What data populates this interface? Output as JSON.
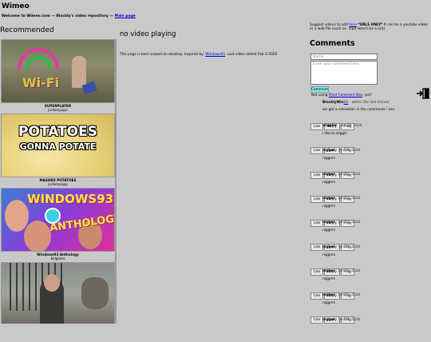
{
  "header": {
    "title": "Wimeo",
    "welcome_text": "Welcome to Wimeo.com — Blockly's video repository —",
    "main_page_link": "Main page"
  },
  "recommended": {
    "heading": "Recommended",
    "items": [
      {
        "title": "SUPERPLAYER",
        "author": "junkenpopp",
        "thumb_text": "Wi-Fi"
      },
      {
        "title": "MASHED POTATOES",
        "author": "junkenpopp",
        "thumb_text_1": "POTATOES",
        "thumb_text_2": "GONNA POTATE"
      },
      {
        "title": "Windows93 Anthology",
        "author": "billgates",
        "thumb_text_1": "WINDOWS93",
        "thumb_text_2": "ANTHOLOGY"
      },
      {
        "title": "",
        "author": ""
      }
    ]
  },
  "player": {
    "status": "no video playing",
    "best_viewed_prefix": "This page is best viewed on desktop. Inspired by:",
    "inspired_link": "Windows93",
    "last_added": ". Last video added Feb-3-2026"
  },
  "suggest": {
    "prefix": "Suggest videos to add",
    "link": "here",
    "bold": "*URLS ONLY*",
    "suffix": "It can be a youtube video or a web file (such as .mp4 (won't be a url))"
  },
  "comments": {
    "heading": "Comments",
    "name_placeholder": "Name",
    "comment_placeholder": "Enter your comment here",
    "submit_label": "Comment",
    "not_using_prefix": "Not using",
    "not_using_link": "Mind Comment Box",
    "not_using_suffix": ", yet?",
    "button_like": "Like",
    "button_reply": "Reply",
    "button_flag": "Flag",
    "items": [
      {
        "author": "BlocklyWin",
        "date": "within the last minute",
        "text": "we got a comedian in the comments i see"
      },
      {
        "author": "wiggler",
        "date": "Jan 28, 2026",
        "text": "i like to wiggle"
      },
      {
        "author": "nigger",
        "date": "Jan 27, 2026",
        "text": "niggers"
      },
      {
        "author": "nigger",
        "date": "Jan 27, 2026",
        "text": "niggers"
      },
      {
        "author": "nigger",
        "date": "Jan 27, 2026",
        "text": "niggers"
      },
      {
        "author": "nigger",
        "date": "Jan 27, 2026",
        "text": "niggers"
      },
      {
        "author": "nigger",
        "date": "Jan 27, 2026",
        "text": "niggers"
      },
      {
        "author": "nigger",
        "date": "Jan 27, 2026",
        "text": "niggers"
      },
      {
        "author": "nigger",
        "date": "Jan 27, 2026",
        "text": "niggers"
      },
      {
        "author": "nigger",
        "date": "Jan 27, 2026",
        "text": ""
      }
    ]
  },
  "icons": {
    "exit": "exit-door-icon"
  }
}
